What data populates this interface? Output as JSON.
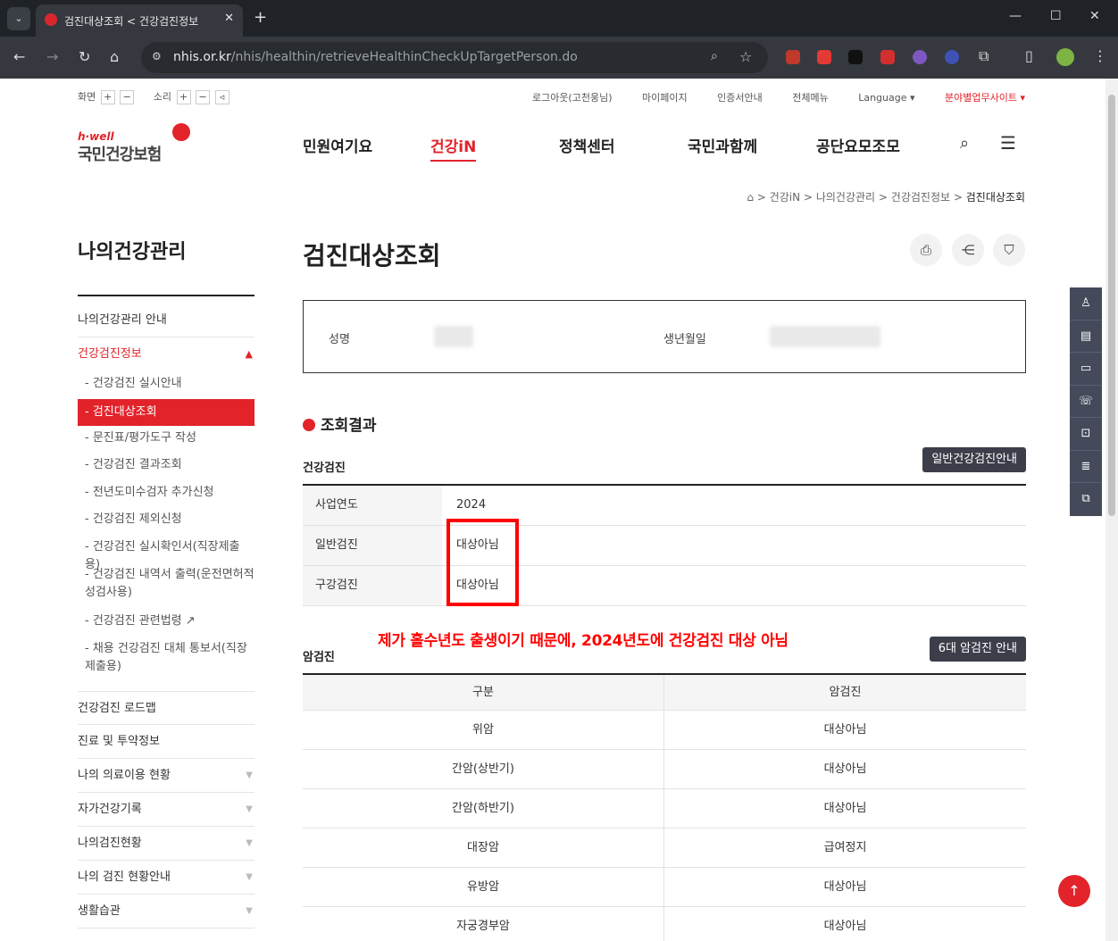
{
  "browser": {
    "tab_title": "검진대상조회 < 건강검진정보",
    "tab_close": "✕",
    "new_tab": "+",
    "url_domain": "nhis.or.kr",
    "url_path": "/nhis/healthin/retrieveHealthinCheckUpTargetPerson.do"
  },
  "util": {
    "screen_label": "화면",
    "sound_label": "소리",
    "plus": "+",
    "minus": "−",
    "links": [
      "로그아웃(고천웅님)",
      "마이페이지",
      "인증서안내",
      "전체메뉴",
      "Language ▾",
      "분야별업무사이트 ▾"
    ]
  },
  "logo": {
    "hwell": "h·well",
    "name": "국민건강보험"
  },
  "gnb": [
    "민원여기요",
    "건강iN",
    "정책센터",
    "국민과함께",
    "공단요모조모"
  ],
  "breadcrumb": {
    "items": [
      "건강iN",
      "나의건강관리",
      "건강검진정보"
    ],
    "current": "검진대상조회",
    "sep": ">"
  },
  "lnb": {
    "title": "나의건강관리",
    "top_items": [
      "나의건강관리 안내",
      "건강검진정보"
    ],
    "sub_items": [
      "건강검진 실시안내",
      "검진대상조회",
      "문진표/평가도구 작성",
      "건강검진 결과조회",
      "전년도미수검자 추가신청",
      "건강검진 제외신청",
      "건강검진 실시확인서(직장제출용)",
      "건강검진 내역서 출력(운전면허적성검사용)",
      "건강검진 관련법령",
      "채용 건강검진 대체 통보서(직장제출용)"
    ],
    "bottom_items": [
      "건강검진 로드맵",
      "진료 및 투약정보",
      "나의 의료이용 현황",
      "자가건강기록",
      "나의검진현황",
      "나의 검진 현황안내",
      "생활습관"
    ]
  },
  "main": {
    "title": "검진대상조회",
    "info": {
      "name_label": "성명",
      "birth_label": "생년월일"
    },
    "result_title": "조회결과",
    "health_checkup": {
      "heading": "건강검진",
      "guide_button": "일반건강검진안내",
      "rows": [
        {
          "label": "사업연도",
          "value": "2024"
        },
        {
          "label": "일반검진",
          "value": "대상아님"
        },
        {
          "label": "구강검진",
          "value": "대상아님"
        }
      ]
    },
    "annotation": "제가 홀수년도 출생이기 때문에, 2024년도에 건강검진 대상 아님",
    "cancer": {
      "heading": "암검진",
      "guide_button": "6대 암검진 안내",
      "headers": [
        "구분",
        "암검진"
      ],
      "rows": [
        [
          "위암",
          "대상아님"
        ],
        [
          "간암(상반기)",
          "대상아님"
        ],
        [
          "간암(하반기)",
          "대상아님"
        ],
        [
          "대장암",
          "급여정지"
        ],
        [
          "유방암",
          "대상아님"
        ],
        [
          "자궁경부암",
          "대상아님"
        ]
      ]
    }
  },
  "icons": {
    "print": "⎙",
    "share": "⋲",
    "bookmark": "⛉",
    "search": "⌕",
    "menu": "☰",
    "top": "↑"
  },
  "colors": {
    "accent": "#e2232a",
    "annotation": "#ff0000",
    "dark_button": "#3c3f4a",
    "quick_menu": "#444a5a"
  }
}
